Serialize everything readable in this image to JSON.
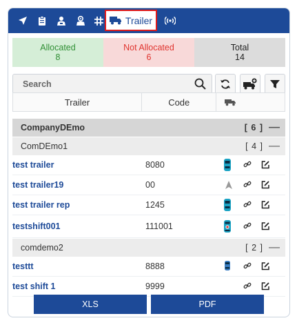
{
  "tabs": [
    {
      "icon": "navigation-arrow-icon"
    },
    {
      "icon": "clipboard-icon"
    },
    {
      "icon": "driver-person-icon"
    },
    {
      "icon": "driver-location-icon"
    },
    {
      "icon": "grid-hash-icon"
    },
    {
      "icon": "trailer-truck-icon",
      "label": "Trailer",
      "active": true
    },
    {
      "icon": "signal-broadcast-icon"
    }
  ],
  "stats": {
    "allocated_label": "Allocated",
    "allocated_value": "8",
    "not_allocated_label": "Not Allocated",
    "not_allocated_value": "6",
    "total_label": "Total",
    "total_value": "14"
  },
  "search": {
    "placeholder": "Search"
  },
  "columns": {
    "trailer": "Trailer",
    "code": "Code"
  },
  "groups": [
    {
      "name": "CompanyDEmo",
      "count": "[ 6 ]",
      "subgroups": [
        {
          "name": "ComDEmo1",
          "count": "[ 4 ]",
          "rows": [
            {
              "name": "test trailer",
              "code": "8080",
              "status": "vehicle-teal"
            },
            {
              "name": "test trailer19",
              "code": "00",
              "status": "arrow-grey"
            },
            {
              "name": "test trailer rep",
              "code": "1245",
              "status": "vehicle-teal"
            },
            {
              "name": "testshift001",
              "code": "111001",
              "status": "vehicle-red-dot"
            }
          ]
        },
        {
          "name": "comdemo2",
          "count": "[ 2 ]",
          "rows": [
            {
              "name": "testtt",
              "code": "8888",
              "status": "vehicle-blue"
            },
            {
              "name": "test shift 1",
              "code": "9999",
              "status": "none"
            }
          ]
        }
      ]
    }
  ],
  "footer": {
    "xls": "XLS",
    "pdf": "PDF"
  },
  "colors": {
    "brand": "#1d4a98",
    "active_border": "#e01a1a",
    "allocated": "#2f8f34",
    "not_allocated": "#e0342f"
  }
}
